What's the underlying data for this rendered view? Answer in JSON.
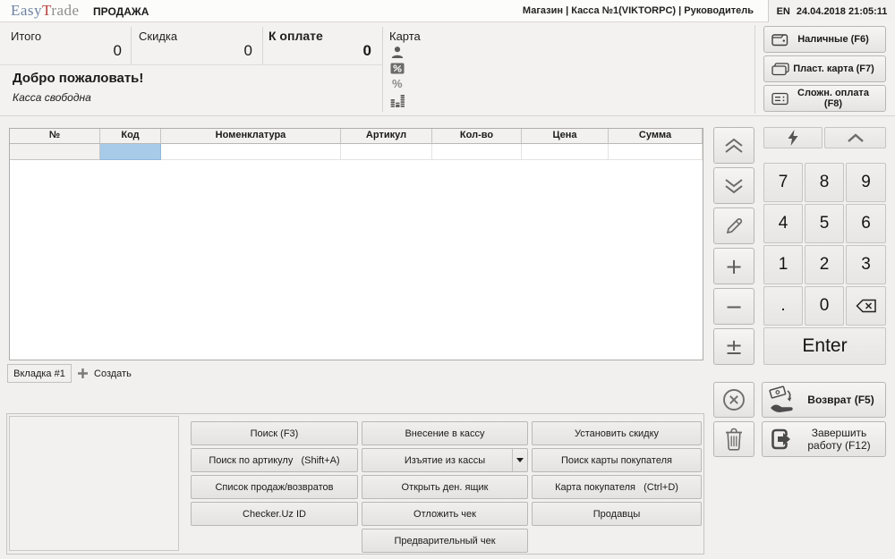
{
  "topbar": {
    "logo_part1": "Easy",
    "logo_part2": "T",
    "logo_part3": "rade",
    "title": "ПРОДАЖА",
    "context": "Магазин | Касса №1(VIKTORPC) | Руководитель",
    "lang": "EN",
    "datetime": "24.04.2018 21:05:11"
  },
  "summary": {
    "total_label": "Итого",
    "total_value": "0",
    "discount_label": "Скидка",
    "discount_value": "0",
    "due_label": "К оплате",
    "due_value": "0",
    "card_label": "Карта",
    "welcome": "Добро пожаловать!",
    "status": "Касса свободна"
  },
  "payments": {
    "cash": "Наличные (F6)",
    "card": "Пласт. карта (F7)",
    "complex": "Сложн. оплата (F8)"
  },
  "table": {
    "columns": [
      "№",
      "Код",
      "Номенклатура",
      "Артикул",
      "Кол-во",
      "Цена",
      "Сумма"
    ]
  },
  "tabs": {
    "tab1": "Вкладка #1",
    "create": "Создать"
  },
  "actions": {
    "rows": [
      [
        "Поиск (F3)",
        "Внесение в кассу",
        "Установить скидку"
      ],
      [
        "Поиск по артикулу   (Shift+A)",
        "Изъятие из кассы",
        "Поиск карты покупателя"
      ],
      [
        "Список продаж/возвратов",
        "Открыть ден. ящик",
        "Карта покупателя   (Ctrl+D)"
      ],
      [
        "Checker.Uz ID",
        "Отложить чек",
        "Продавцы"
      ]
    ],
    "preview": "Предварительный чек"
  },
  "numpad": {
    "keys": [
      "7",
      "8",
      "9",
      "4",
      "5",
      "6",
      "1",
      "2",
      "3",
      ".",
      "0"
    ],
    "enter": "Enter"
  },
  "side": {
    "return_label": "Возврат (F5)",
    "finish_label": "Завершить работу (F12)"
  },
  "icons": {
    "percent": "%",
    "plus": "+",
    "minus": "−",
    "plus_minus": "±"
  },
  "colors": {
    "selected_cell": "#a7cbe9",
    "logo_blue": "#6f84a1",
    "logo_red": "#b5423a",
    "icon_gray": "#5d5d5d"
  }
}
